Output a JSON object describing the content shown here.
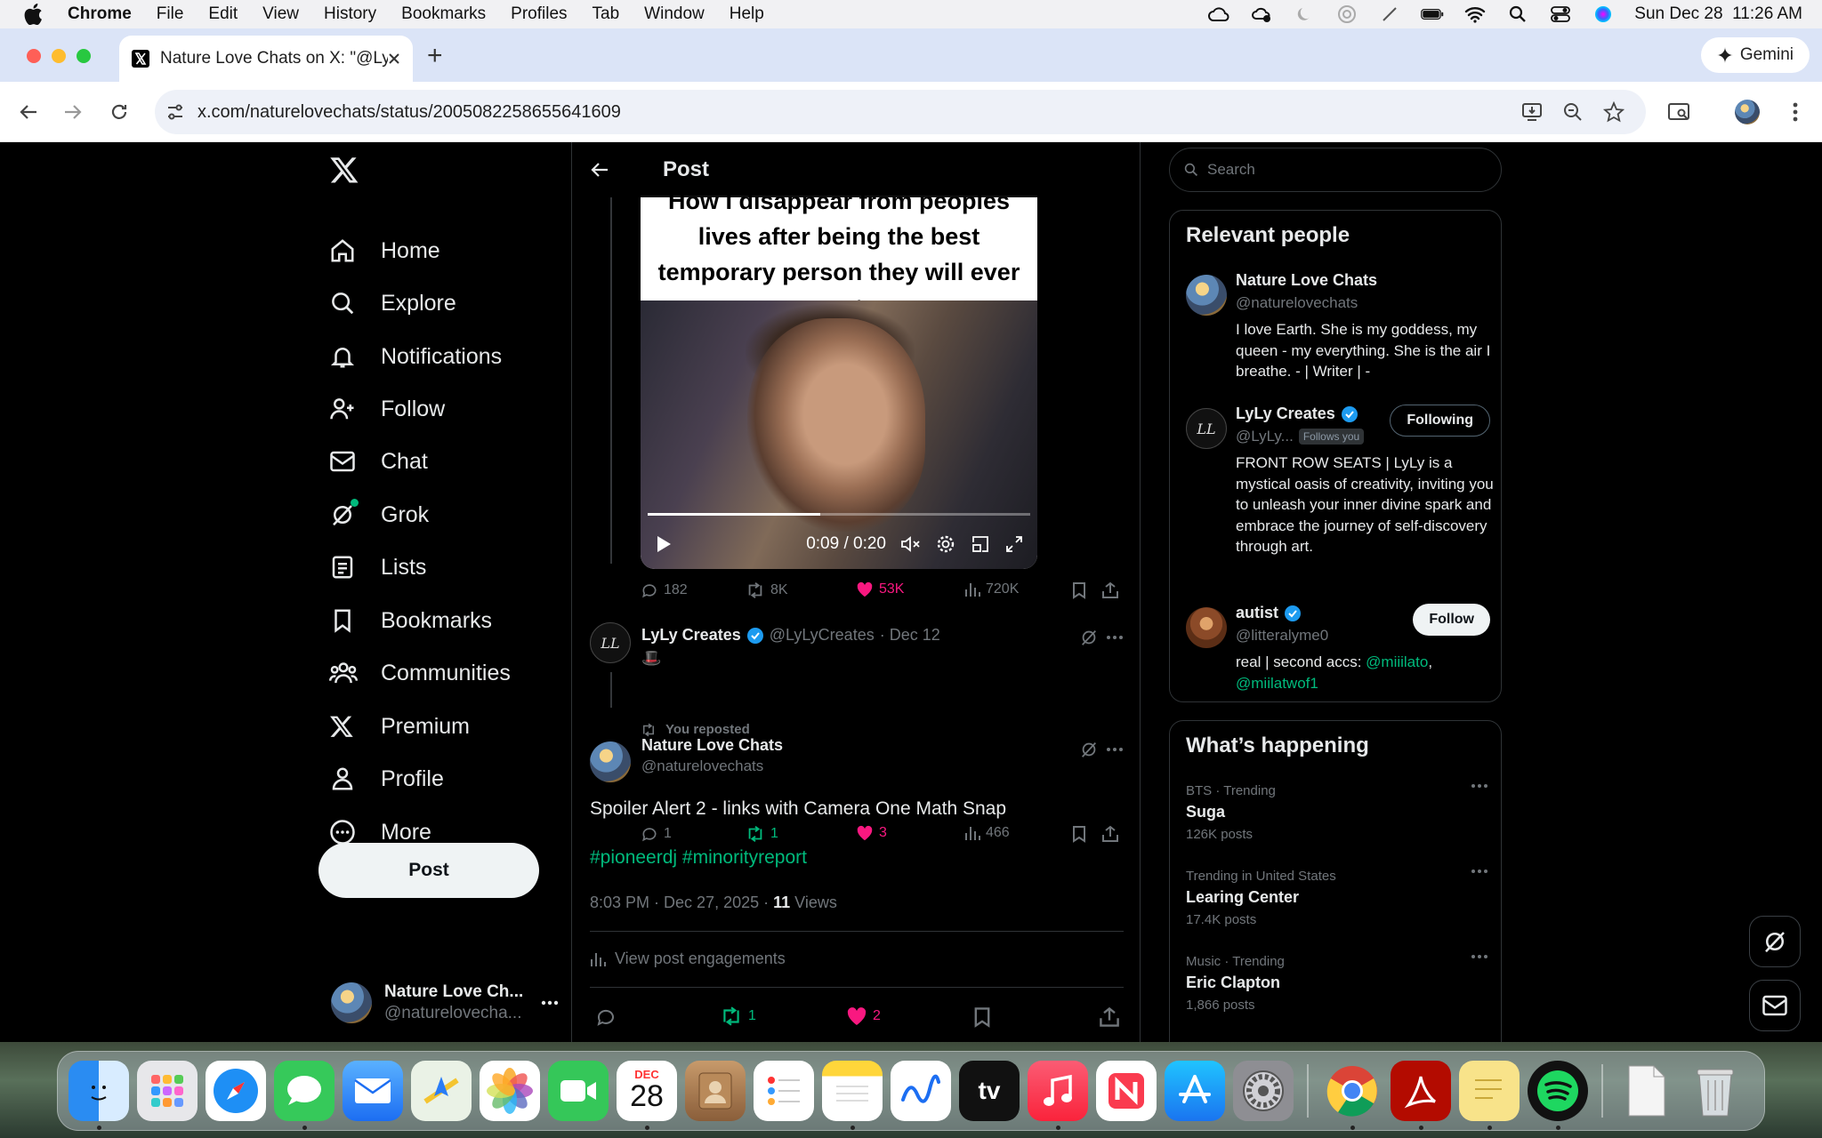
{
  "menubar": {
    "app": "Chrome",
    "items": [
      "File",
      "Edit",
      "View",
      "History",
      "Bookmarks",
      "Profiles",
      "Tab",
      "Window",
      "Help"
    ],
    "datetime": "Sun Dec 28  11:26 AM"
  },
  "browser": {
    "tab_title": "Nature Love Chats on X: \"@LyLy",
    "gemini_label": "Gemini",
    "url": "x.com/naturelovechats/status/2005082258655641609"
  },
  "nav": {
    "items": [
      "Home",
      "Explore",
      "Notifications",
      "Follow",
      "Chat",
      "Grok",
      "Lists",
      "Bookmarks",
      "Communities",
      "Premium",
      "Profile",
      "More"
    ],
    "post_button": "Post",
    "account_name": "Nature Love Ch...",
    "account_handle": "@naturelovecha..."
  },
  "header": {
    "title": "Post"
  },
  "media": {
    "caption": "How I disappear from peoples lives after being the best temporary person they will ever meet:",
    "time": "0:09 / 0:20",
    "progress": 0.45
  },
  "quoted_stats": {
    "replies": "182",
    "reposts": "8K",
    "likes": "53K",
    "views": "720K"
  },
  "reply": {
    "name": "LyLy Creates",
    "handle": "@LyLyCreates",
    "date": "· Dec 12",
    "text": "🎩",
    "stats": {
      "replies": "1",
      "reposts": "1",
      "likes": "3",
      "views": "466"
    }
  },
  "main_post": {
    "repost_label": "You reposted",
    "name": "Nature Love Chats",
    "handle": "@naturelovechats",
    "text": "Spoiler Alert 2 - links with Camera One Math Snap",
    "hashtags": "#pioneerdj #minorityreport",
    "meta_time": "8:03 PM · Dec 27, 2025 · ",
    "views_count": "11",
    "views_label": " Views",
    "engagements": "View post engagements",
    "stats": {
      "reposts": "1",
      "likes": "2"
    }
  },
  "search": {
    "placeholder": "Search"
  },
  "relevant": {
    "title": "Relevant people",
    "people": [
      {
        "name": "Nature Love Chats",
        "handle": "@naturelovechats",
        "bio": "I love Earth. She is my goddess, my queen - my everything. She is the air I breathe. - | Writer | -"
      },
      {
        "name": "LyLy Creates",
        "handle": "@LyLy...",
        "follows_you": "Follows you",
        "button": "Following",
        "bio": "FRONT ROW SEATS | LyLy is a mystical oasis of creativity, inviting you to unleash your inner divine spark and embrace the journey of self-discovery through art."
      },
      {
        "name": "autist",
        "handle": "@litteralyme0",
        "button": "Follow",
        "bio_prefix": "real | second accs: ",
        "link1": "@miiilato",
        "link_sep": ",",
        "link2": "@miilatwof1"
      }
    ]
  },
  "happening": {
    "title": "What’s happening",
    "trends": [
      {
        "category": "BTS · Trending",
        "name": "Suga",
        "count": "126K posts"
      },
      {
        "category": "Trending in United States",
        "name": "Learing Center",
        "count": "17.4K posts"
      },
      {
        "category": "Music · Trending",
        "name": "Eric Clapton",
        "count": "1,866 posts"
      }
    ]
  },
  "dock": {
    "calendar_month": "DEC",
    "calendar_day": "28",
    "tv_label": "tv"
  },
  "colors": {
    "like": "#f91880",
    "repost": "#00ba7c",
    "link": "#00ba7c",
    "verified": "#1d9bf0"
  }
}
